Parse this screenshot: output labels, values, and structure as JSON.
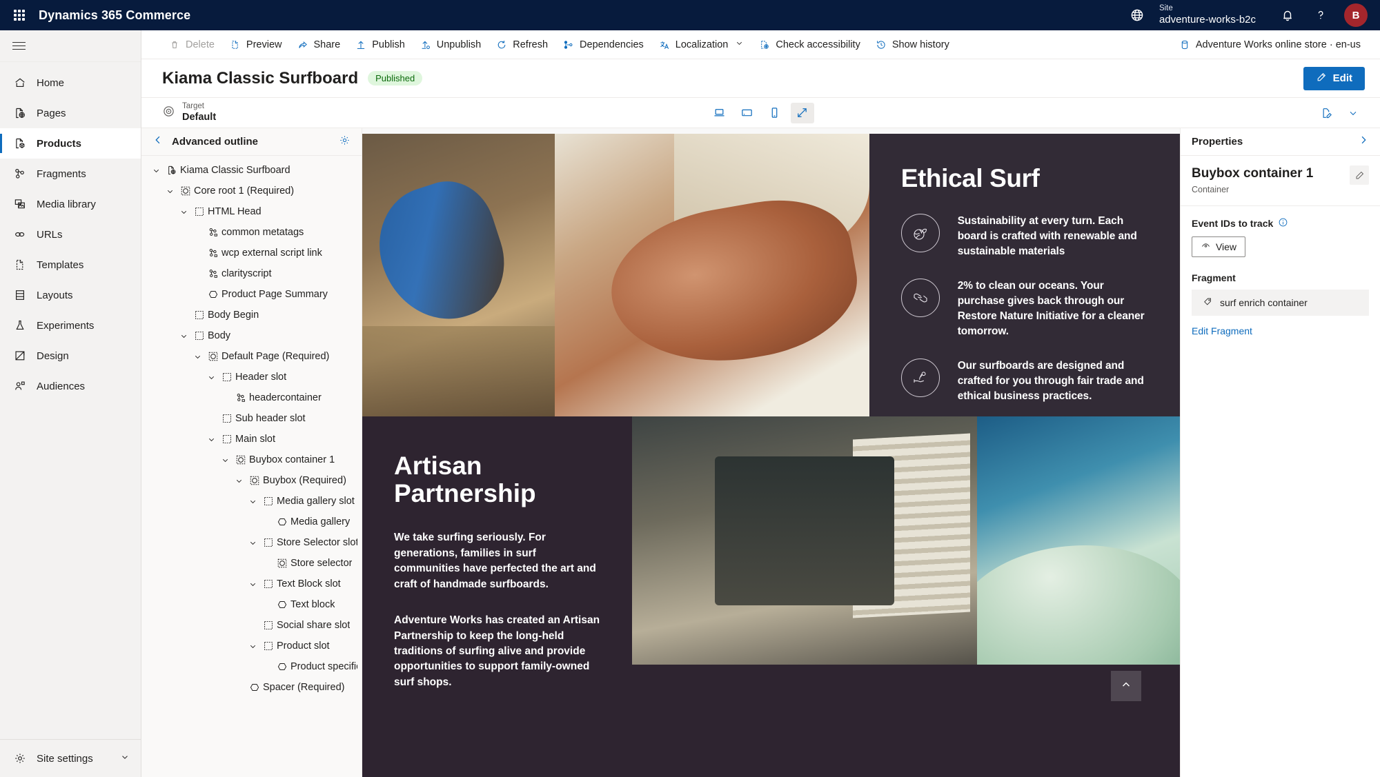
{
  "suitebar": {
    "waffle": "app-launcher",
    "title": "Dynamics 365 Commerce",
    "site_label": "Site",
    "site_value": "adventure-works-b2c",
    "avatar_initial": "B",
    "globe_icon": "globe-icon",
    "bell_icon": "notification-bell-icon",
    "help_icon": "help-question-icon"
  },
  "leftnav": {
    "items": [
      {
        "label": "Home",
        "icon": "home-icon",
        "active": false
      },
      {
        "label": "Pages",
        "icon": "page-globe-icon",
        "active": false
      },
      {
        "label": "Products",
        "icon": "product-page-icon",
        "active": true
      },
      {
        "label": "Fragments",
        "icon": "fragments-icon",
        "active": false
      },
      {
        "label": "Media library",
        "icon": "media-library-icon",
        "active": false
      },
      {
        "label": "URLs",
        "icon": "link-icon",
        "active": false
      },
      {
        "label": "Templates",
        "icon": "template-icon",
        "active": false
      },
      {
        "label": "Layouts",
        "icon": "layout-icon",
        "active": false
      },
      {
        "label": "Experiments",
        "icon": "beaker-icon",
        "active": false
      },
      {
        "label": "Design",
        "icon": "design-icon",
        "active": false
      },
      {
        "label": "Audiences",
        "icon": "audiences-icon",
        "active": false
      }
    ],
    "footer": {
      "label": "Site settings",
      "icon": "gear-icon",
      "chevron": "chevron-down-icon"
    }
  },
  "commandbar": {
    "items": [
      {
        "label": "Delete",
        "icon": "trash-icon",
        "disabled": true,
        "chevron": false
      },
      {
        "label": "Preview",
        "icon": "preview-page-icon",
        "disabled": false,
        "chevron": false
      },
      {
        "label": "Share",
        "icon": "share-icon",
        "disabled": false,
        "chevron": false
      },
      {
        "label": "Publish",
        "icon": "publish-up-arrow-icon",
        "disabled": false,
        "chevron": false
      },
      {
        "label": "Unpublish",
        "icon": "unpublish-icon",
        "disabled": false,
        "chevron": false
      },
      {
        "label": "Refresh",
        "icon": "refresh-icon",
        "disabled": false,
        "chevron": false
      },
      {
        "label": "Dependencies",
        "icon": "dependencies-icon",
        "disabled": false,
        "chevron": false
      },
      {
        "label": "Localization",
        "icon": "localization-icon",
        "disabled": false,
        "chevron": true
      },
      {
        "label": "Check accessibility",
        "icon": "accessibility-check-icon",
        "disabled": false,
        "chevron": false
      },
      {
        "label": "Show history",
        "icon": "history-clock-icon",
        "disabled": false,
        "chevron": false
      }
    ],
    "channel": {
      "label": "Adventure Works online store · en-us",
      "icon": "channel-icon"
    }
  },
  "title_row": {
    "page_title": "Kiama Classic Surfboard",
    "status_badge": "Published",
    "edit_button": "Edit",
    "edit_icon": "pencil-icon"
  },
  "target_bar": {
    "target_label": "Target",
    "target_value": "Default",
    "target_icon": "target-icon",
    "devices": [
      {
        "name": "desktop-view",
        "selected": false
      },
      {
        "name": "tablet-view",
        "selected": false
      },
      {
        "name": "mobile-view",
        "selected": false
      },
      {
        "name": "fullscreen-view",
        "selected": true
      }
    ],
    "right_icons": [
      "page-edit-icon",
      "chevron-down-icon"
    ]
  },
  "outline": {
    "header": "Advanced outline",
    "back_icon": "chevron-left-icon",
    "settings_icon": "gear-icon",
    "nodes": [
      {
        "label": "Kiama Classic Surfboard",
        "depth": 0,
        "twist": "expanded",
        "icon": "page-globe-icon"
      },
      {
        "label": "Core root 1 (Required)",
        "depth": 1,
        "twist": "expanded",
        "icon": "module-icon"
      },
      {
        "label": "HTML Head",
        "depth": 2,
        "twist": "expanded",
        "icon": "slot-icon"
      },
      {
        "label": "common metatags",
        "depth": 3,
        "twist": "none",
        "icon": "fragment-icon"
      },
      {
        "label": "wcp external script link",
        "depth": 3,
        "twist": "none",
        "icon": "fragment-icon"
      },
      {
        "label": "clarityscript",
        "depth": 3,
        "twist": "none",
        "icon": "fragment-icon"
      },
      {
        "label": "Product Page Summary",
        "depth": 3,
        "twist": "none",
        "icon": "hexagon-icon"
      },
      {
        "label": "Body Begin",
        "depth": 2,
        "twist": "none",
        "icon": "slot-icon"
      },
      {
        "label": "Body",
        "depth": 2,
        "twist": "expanded",
        "icon": "slot-icon"
      },
      {
        "label": "Default Page (Required)",
        "depth": 3,
        "twist": "expanded",
        "icon": "module-icon"
      },
      {
        "label": "Header slot",
        "depth": 4,
        "twist": "expanded",
        "icon": "slot-icon"
      },
      {
        "label": "headercontainer",
        "depth": 5,
        "twist": "none",
        "icon": "fragment-icon"
      },
      {
        "label": "Sub header slot",
        "depth": 4,
        "twist": "none",
        "icon": "slot-icon"
      },
      {
        "label": "Main slot",
        "depth": 4,
        "twist": "expanded",
        "icon": "slot-icon"
      },
      {
        "label": "Buybox container 1",
        "depth": 5,
        "twist": "expanded",
        "icon": "module-icon"
      },
      {
        "label": "Buybox (Required)",
        "depth": 6,
        "twist": "expanded",
        "icon": "module-icon"
      },
      {
        "label": "Media gallery slot",
        "depth": 7,
        "twist": "expanded",
        "icon": "slot-icon"
      },
      {
        "label": "Media gallery",
        "depth": 8,
        "twist": "none",
        "icon": "hexagon-icon"
      },
      {
        "label": "Store Selector slot",
        "depth": 7,
        "twist": "expanded",
        "icon": "slot-icon"
      },
      {
        "label": "Store selector",
        "depth": 8,
        "twist": "none",
        "icon": "module-icon"
      },
      {
        "label": "Text Block slot",
        "depth": 7,
        "twist": "expanded",
        "icon": "slot-icon"
      },
      {
        "label": "Text block",
        "depth": 8,
        "twist": "none",
        "icon": "hexagon-icon"
      },
      {
        "label": "Social share slot",
        "depth": 7,
        "twist": "none",
        "icon": "slot-icon"
      },
      {
        "label": "Product slot",
        "depth": 7,
        "twist": "expanded",
        "icon": "slot-icon"
      },
      {
        "label": "Product specification",
        "depth": 8,
        "twist": "none",
        "icon": "hexagon-icon"
      },
      {
        "label": "Spacer (Required)",
        "depth": 6,
        "twist": "none",
        "icon": "hexagon-icon"
      }
    ]
  },
  "preview": {
    "hero": {
      "title": "Ethical Surf",
      "features": [
        {
          "icon": "globe-plant-icon",
          "text": "Sustainability at every turn. Each board is crafted with renewable and sustainable materials"
        },
        {
          "icon": "giving-hands-icon",
          "text": "2% to clean our oceans. Your purchase gives back through our Restore Nature Initiative for a cleaner tomorrow."
        },
        {
          "icon": "hand-flower-icon",
          "text": "Our surfboards are designed and crafted for you through fair trade and ethical business practices."
        }
      ]
    },
    "artisan": {
      "title": "Artisan Partnership",
      "paragraphs": [
        "We take surfing seriously. For generations, families in surf communities have perfected the art and craft of handmade surfboards.",
        "Adventure Works has created an Artisan Partnership to keep the long-held traditions of surfing alive and provide opportunities to support family-owned surf shops."
      ]
    },
    "scroll_top_icon": "chevron-up-icon"
  },
  "properties": {
    "header": "Properties",
    "collapse_icon": "chevron-right-icon",
    "name": "Buybox container 1",
    "type": "Container",
    "edit_name_icon": "pencil-icon",
    "event_ids_label": "Event IDs to track",
    "info_icon": "info-icon",
    "view_button": "View",
    "view_icon": "eye-icon",
    "fragment_label": "Fragment",
    "fragment_name": "surf enrich container",
    "fragment_icon": "tag-icon",
    "edit_fragment_link": "Edit Fragment"
  },
  "colors": {
    "suitebar": "#071B3D",
    "accent": "#0F6CBD",
    "published_badge_bg": "#DFF6DD",
    "published_badge_fg": "#0B6A0B",
    "avatar_bg": "#A4262C",
    "preview_bg": "#322B36"
  }
}
